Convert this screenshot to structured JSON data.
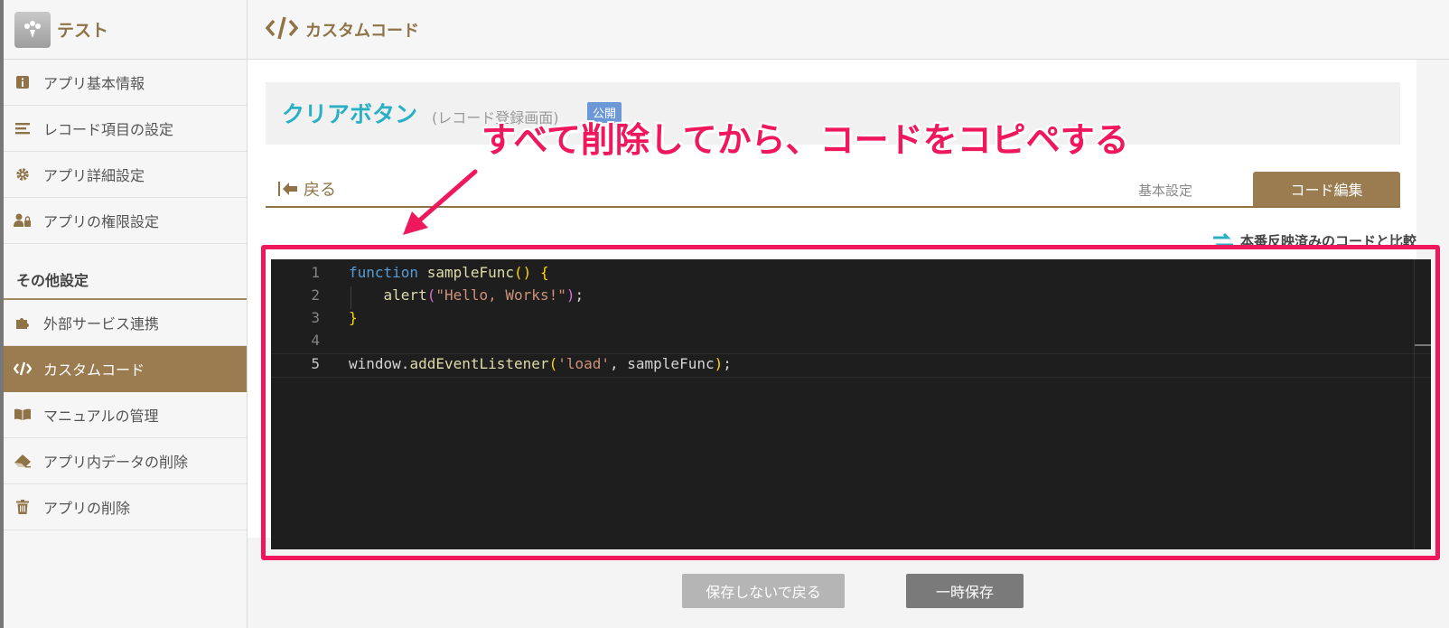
{
  "app": {
    "name": "テスト"
  },
  "header": {
    "title": "カスタムコード"
  },
  "sidebar": {
    "items": [
      {
        "label": "アプリ基本情報",
        "icon": "info-icon"
      },
      {
        "label": "レコード項目の設定",
        "icon": "list-icon"
      },
      {
        "label": "アプリ詳細設定",
        "icon": "gear-icon"
      },
      {
        "label": "アプリの権限設定",
        "icon": "user-lock-icon"
      }
    ],
    "section_title": "その他設定",
    "other_items": [
      {
        "label": "外部サービス連携",
        "icon": "puzzle-icon"
      },
      {
        "label": "カスタムコード",
        "icon": "code-icon",
        "active": true
      },
      {
        "label": "マニュアルの管理",
        "icon": "book-icon"
      },
      {
        "label": "アプリ内データの削除",
        "icon": "eraser-icon"
      },
      {
        "label": "アプリの削除",
        "icon": "trash-icon"
      }
    ]
  },
  "page": {
    "name": "クリアボタン",
    "subtitle": "(レコード登録画面)",
    "badge": "公開"
  },
  "tabs": {
    "back_label": "戻る",
    "basic": "基本設定",
    "code": "コード編集"
  },
  "compare_link": "本番反映済みのコードと比較",
  "editor": {
    "lines": [
      {
        "no": "1",
        "code": "function sampleFunc() {"
      },
      {
        "no": "2",
        "code": "    alert(\"Hello, Works!\");"
      },
      {
        "no": "3",
        "code": "}"
      },
      {
        "no": "4",
        "code": ""
      },
      {
        "no": "5",
        "code": "window.addEventListener('load', sampleFunc);"
      }
    ]
  },
  "buttons": {
    "cancel": "保存しないで戻る",
    "save": "一時保存"
  },
  "annotation": {
    "text": "すべて削除してから、コードをコピペする",
    "color": "#f0185c"
  },
  "colors": {
    "brand": "#9a7c50",
    "title": "#2ab0c4",
    "badge": "#6c98d8"
  }
}
